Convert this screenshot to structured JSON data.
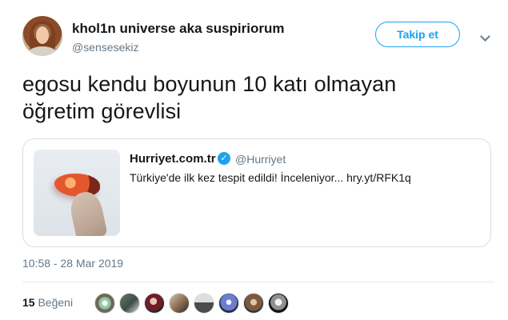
{
  "tweet": {
    "author": {
      "display_name": "khol1n universe aka suspiriorum",
      "handle": "@sensesekiz"
    },
    "follow_label": "Takip et",
    "text": "egosu kendu boyunun 10 katı olmayan öğretim görevlisi",
    "quoted_tweet": {
      "name": "Hurriyet.com.tr",
      "handle": "@Hurriyet",
      "text": "Türkiye'de ilk kez tespit edildi! İnceleniyor... hry.yt/RFK1q"
    },
    "timestamp": "10:58 - 28 Mar 2019",
    "likes_count": "15",
    "likes_label": "Beğeni"
  },
  "icons": {
    "menu": "chevron-down-icon",
    "verified": "verified-icon"
  },
  "colors": {
    "accent": "#1da1f2",
    "muted": "#657786",
    "text": "#14171a",
    "border": "#d8dee3"
  }
}
